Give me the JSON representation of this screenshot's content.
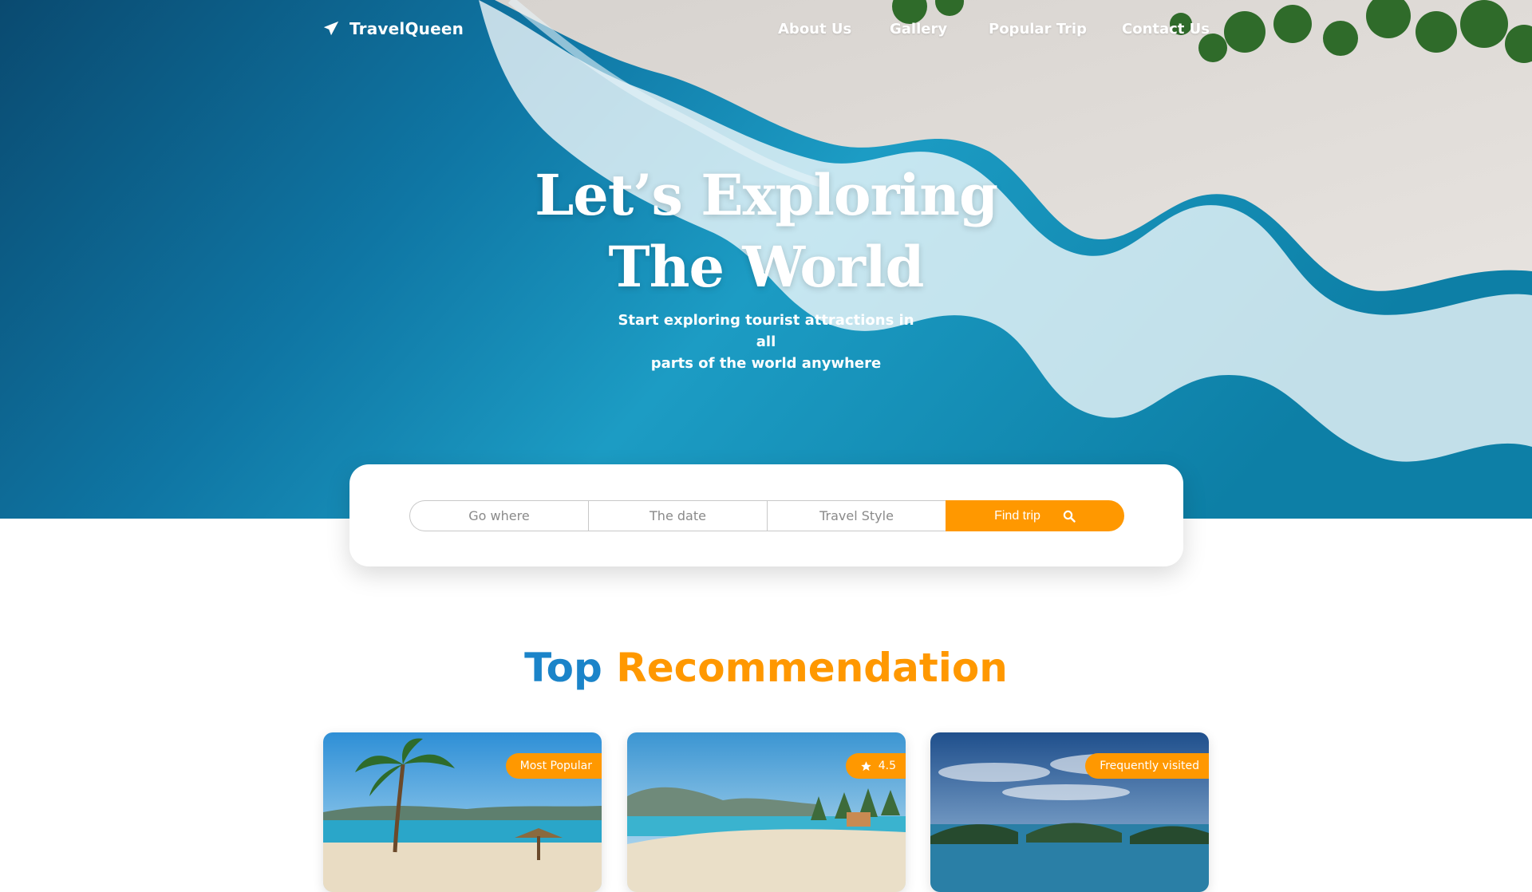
{
  "nav": {
    "brand": "TravelQueen",
    "links": [
      "About Us",
      "Gallery",
      "Popular Trip",
      "Contact Us"
    ]
  },
  "hero": {
    "title_line1": "Let’s Exploring",
    "title_line2": "The World",
    "subtitle_line1": "Start exploring tourist attractions in all",
    "subtitle_line2": "parts of the world anywhere"
  },
  "search": {
    "go_where": "Go where",
    "date": "The date",
    "style": "Travel Style",
    "button": "Find trip"
  },
  "section": {
    "title_part1": "Top",
    "title_part2": "Recommendation"
  },
  "cards": [
    {
      "badge": "Most Popular",
      "icon": ""
    },
    {
      "badge": "4.5",
      "icon": "star-icon"
    },
    {
      "badge": "Frequently visited",
      "icon": ""
    }
  ],
  "colors": {
    "accent": "#ff9800",
    "title_blue": "#1b84c9",
    "white": "#ffffff"
  }
}
